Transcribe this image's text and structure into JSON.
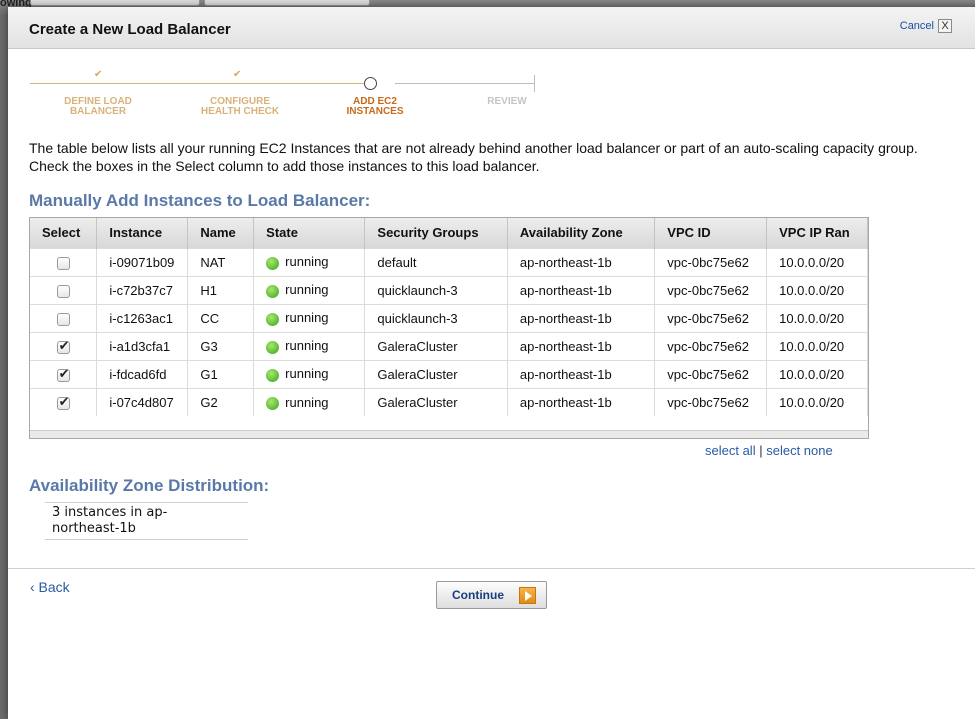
{
  "background": {
    "label": "owing:"
  },
  "dialog": {
    "title": "Create a New Load Balancer",
    "cancel_label": "Cancel",
    "close_glyph": "X"
  },
  "wizard": {
    "steps": [
      {
        "line1": "DEFINE LOAD",
        "line2": "BALANCER",
        "status": "done"
      },
      {
        "line1": "CONFIGURE",
        "line2": "HEALTH CHECK",
        "status": "done"
      },
      {
        "line1": "ADD EC2",
        "line2": "INSTANCES",
        "status": "active"
      },
      {
        "line1": "REVIEW",
        "line2": "",
        "status": "todo"
      }
    ],
    "check_glyph": "✔"
  },
  "intro_text": "The table below lists all your running EC2 Instances that are not already behind another load balancer or part of an auto-scaling capacity group. Check the boxes in the Select column to add those instances to this load balancer.",
  "manual_section_title": "Manually Add Instances to Load Balancer:",
  "table": {
    "headers": [
      "Select",
      "Instance",
      "Name",
      "State",
      "Security Groups",
      "Availability Zone",
      "VPC ID",
      "VPC IP Ran"
    ],
    "rows": [
      {
        "checked": false,
        "instance": "i-09071b09",
        "name": "NAT",
        "state": "running",
        "security_group": "default",
        "zone": "ap-northeast-1b",
        "vpc_id": "vpc-0bc75e62",
        "vpc_ip": "10.0.0.0/20"
      },
      {
        "checked": false,
        "instance": "i-c72b37c7",
        "name": "H1",
        "state": "running",
        "security_group": "quicklaunch-3",
        "zone": "ap-northeast-1b",
        "vpc_id": "vpc-0bc75e62",
        "vpc_ip": "10.0.0.0/20"
      },
      {
        "checked": false,
        "instance": "i-c1263ac1",
        "name": "CC",
        "state": "running",
        "security_group": "quicklaunch-3",
        "zone": "ap-northeast-1b",
        "vpc_id": "vpc-0bc75e62",
        "vpc_ip": "10.0.0.0/20"
      },
      {
        "checked": true,
        "instance": "i-a1d3cfa1",
        "name": "G3",
        "state": "running",
        "security_group": "GaleraCluster",
        "zone": "ap-northeast-1b",
        "vpc_id": "vpc-0bc75e62",
        "vpc_ip": "10.0.0.0/20"
      },
      {
        "checked": true,
        "instance": "i-fdcad6fd",
        "name": "G1",
        "state": "running",
        "security_group": "GaleraCluster",
        "zone": "ap-northeast-1b",
        "vpc_id": "vpc-0bc75e62",
        "vpc_ip": "10.0.0.0/20"
      },
      {
        "checked": true,
        "instance": "i-07c4d807",
        "name": "G2",
        "state": "running",
        "security_group": "GaleraCluster",
        "zone": "ap-northeast-1b",
        "vpc_id": "vpc-0bc75e62",
        "vpc_ip": "10.0.0.0/20"
      }
    ]
  },
  "selection": {
    "select_all": "select all",
    "separator": "|",
    "select_none": "select none"
  },
  "az_section_title": "Availability Zone Distribution:",
  "az_distribution": {
    "line1": "3 instances in ap-",
    "line2": "northeast-1b"
  },
  "footer": {
    "back_label": "‹ Back",
    "continue_label": "Continue"
  },
  "colors": {
    "accent": "#5a78a8",
    "wizard_done": "#d9b27b",
    "wizard_active": "#c76a1c",
    "running": "#3aa31e",
    "link": "#2b5aa3"
  }
}
